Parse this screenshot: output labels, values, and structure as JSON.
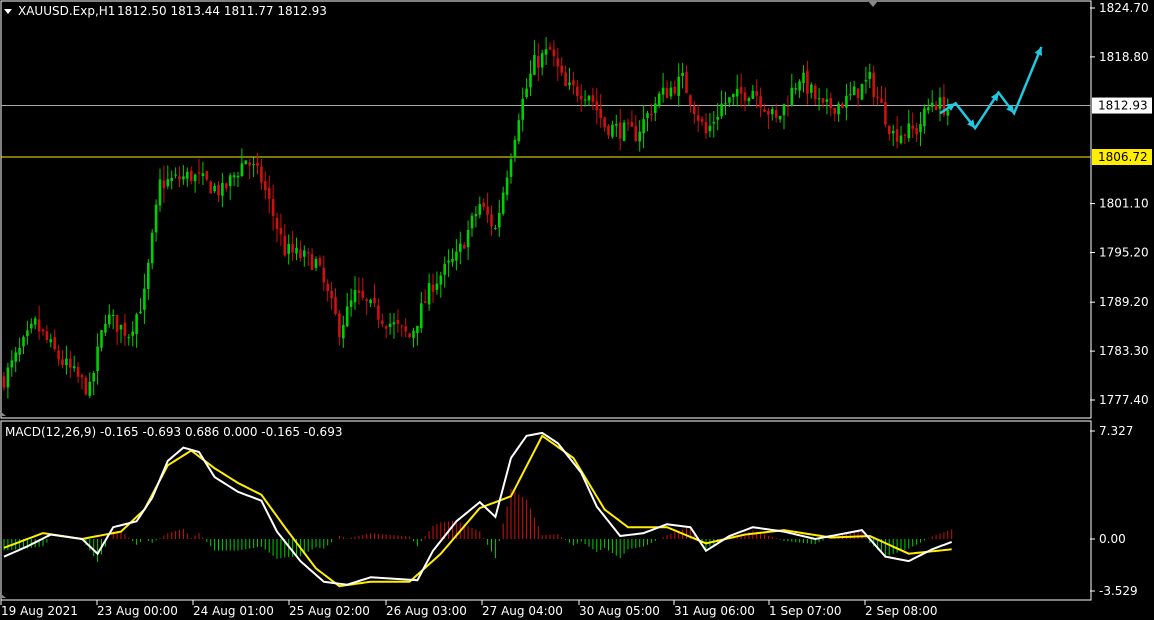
{
  "header": {
    "symbol_info": "XAUUSD.Exp,H1",
    "ohlc": "1812.50 1813.44 1811.77 1812.93"
  },
  "price_axis": {
    "labels": [
      "1824.70",
      "1818.80",
      "1801.10",
      "1795.20",
      "1789.20",
      "1783.30",
      "1777.40"
    ],
    "current_price": "1812.93",
    "level_price": "1806.72"
  },
  "macd": {
    "title": "MACD(12,26,9) -0.165 -0.693 0.686 0.000 -0.165 -0.693",
    "axis_labels": [
      "7.327",
      "0.00",
      "-3.529"
    ]
  },
  "time_axis": {
    "labels": [
      "19 Aug 2021",
      "23 Aug 00:00",
      "24 Aug 01:00",
      "25 Aug 02:00",
      "26 Aug 03:00",
      "27 Aug 04:00",
      "30 Aug 05:00",
      "31 Aug 06:00",
      "1 Sep 07:00",
      "2 Sep 08:00"
    ]
  },
  "colors": {
    "background": "#000000",
    "bull_candle": "#00d000",
    "bear_candle": "#d01010",
    "macd_line": "#ffffff",
    "signal_line": "#ffee00",
    "forecast_arrow": "#20c8e0",
    "level_line": "#ffee00",
    "current_line": "#aaaaaa"
  },
  "chart_data": [
    {
      "type": "candlestick",
      "symbol": "XAUUSD",
      "timeframe": "H1",
      "ylim": [
        1775.0,
        1827.0
      ],
      "anchors": [
        {
          "t": 0,
          "p": 1780.0
        },
        {
          "t": 8,
          "p": 1786.5
        },
        {
          "t": 14,
          "p": 1782.5
        },
        {
          "t": 22,
          "p": 1778.5
        },
        {
          "t": 26,
          "p": 1787.5
        },
        {
          "t": 32,
          "p": 1785.5
        },
        {
          "t": 36,
          "p": 1790.0
        },
        {
          "t": 40,
          "p": 1803.5
        },
        {
          "t": 48,
          "p": 1804.5
        },
        {
          "t": 56,
          "p": 1802.5
        },
        {
          "t": 62,
          "p": 1806.5
        },
        {
          "t": 66,
          "p": 1804.0
        },
        {
          "t": 72,
          "p": 1795.5
        },
        {
          "t": 80,
          "p": 1794.0
        },
        {
          "t": 86,
          "p": 1786.0
        },
        {
          "t": 90,
          "p": 1790.0
        },
        {
          "t": 98,
          "p": 1787.0
        },
        {
          "t": 104,
          "p": 1785.0
        },
        {
          "t": 110,
          "p": 1791.5
        },
        {
          "t": 116,
          "p": 1794.5
        },
        {
          "t": 122,
          "p": 1801.0
        },
        {
          "t": 126,
          "p": 1798.0
        },
        {
          "t": 132,
          "p": 1812.0
        },
        {
          "t": 136,
          "p": 1818.0
        },
        {
          "t": 140,
          "p": 1819.5
        },
        {
          "t": 144,
          "p": 1815.0
        },
        {
          "t": 150,
          "p": 1814.5
        },
        {
          "t": 154,
          "p": 1810.5
        },
        {
          "t": 162,
          "p": 1809.5
        },
        {
          "t": 168,
          "p": 1814.0
        },
        {
          "t": 174,
          "p": 1816.0
        },
        {
          "t": 180,
          "p": 1809.5
        },
        {
          "t": 184,
          "p": 1813.0
        },
        {
          "t": 192,
          "p": 1815.0
        },
        {
          "t": 198,
          "p": 1811.0
        },
        {
          "t": 204,
          "p": 1816.5
        },
        {
          "t": 210,
          "p": 1812.5
        },
        {
          "t": 216,
          "p": 1813.5
        },
        {
          "t": 222,
          "p": 1816.0
        },
        {
          "t": 228,
          "p": 1809.5
        },
        {
          "t": 234,
          "p": 1810.0
        },
        {
          "t": 238,
          "p": 1813.5
        },
        {
          "t": 242,
          "p": 1812.5
        }
      ],
      "forecast_path": [
        {
          "t": 240,
          "p": 1812.0
        },
        {
          "t": 244,
          "p": 1813.2
        },
        {
          "t": 249,
          "p": 1810.2
        },
        {
          "t": 255,
          "p": 1814.5
        },
        {
          "t": 259,
          "p": 1812.0
        },
        {
          "t": 266,
          "p": 1820.0
        }
      ]
    },
    {
      "type": "line",
      "title": "MACD(12,26,9) -0.165 -0.693 0.686 0.000 -0.165 -0.693",
      "ylim": [
        -3.529,
        7.327
      ],
      "anchors_macd": [
        {
          "t": 0,
          "v": -1.2
        },
        {
          "t": 6,
          "v": -0.5
        },
        {
          "t": 12,
          "v": 0.3
        },
        {
          "t": 20,
          "v": 0.0
        },
        {
          "t": 24,
          "v": -1.0
        },
        {
          "t": 28,
          "v": 0.8
        },
        {
          "t": 34,
          "v": 1.2
        },
        {
          "t": 38,
          "v": 2.8
        },
        {
          "t": 42,
          "v": 5.3
        },
        {
          "t": 46,
          "v": 6.2
        },
        {
          "t": 50,
          "v": 5.9
        },
        {
          "t": 54,
          "v": 4.2
        },
        {
          "t": 60,
          "v": 3.2
        },
        {
          "t": 66,
          "v": 2.6
        },
        {
          "t": 70,
          "v": 0.5
        },
        {
          "t": 76,
          "v": -1.5
        },
        {
          "t": 82,
          "v": -2.9
        },
        {
          "t": 88,
          "v": -3.1
        },
        {
          "t": 94,
          "v": -2.6
        },
        {
          "t": 100,
          "v": -2.7
        },
        {
          "t": 106,
          "v": -2.8
        },
        {
          "t": 110,
          "v": -0.8
        },
        {
          "t": 116,
          "v": 1.2
        },
        {
          "t": 122,
          "v": 2.5
        },
        {
          "t": 126,
          "v": 1.5
        },
        {
          "t": 130,
          "v": 5.5
        },
        {
          "t": 134,
          "v": 7.0
        },
        {
          "t": 138,
          "v": 7.2
        },
        {
          "t": 142,
          "v": 6.5
        },
        {
          "t": 148,
          "v": 4.5
        },
        {
          "t": 152,
          "v": 2.2
        },
        {
          "t": 158,
          "v": 0.2
        },
        {
          "t": 164,
          "v": 0.4
        },
        {
          "t": 170,
          "v": 1.0
        },
        {
          "t": 176,
          "v": 0.8
        },
        {
          "t": 180,
          "v": -0.8
        },
        {
          "t": 186,
          "v": 0.2
        },
        {
          "t": 192,
          "v": 0.8
        },
        {
          "t": 200,
          "v": 0.5
        },
        {
          "t": 208,
          "v": 0.0
        },
        {
          "t": 214,
          "v": 0.3
        },
        {
          "t": 220,
          "v": 0.6
        },
        {
          "t": 226,
          "v": -1.2
        },
        {
          "t": 232,
          "v": -1.5
        },
        {
          "t": 238,
          "v": -0.7
        },
        {
          "t": 243,
          "v": -0.2
        }
      ],
      "anchors_signal": [
        {
          "t": 0,
          "v": -0.6
        },
        {
          "t": 10,
          "v": 0.4
        },
        {
          "t": 20,
          "v": 0.0
        },
        {
          "t": 30,
          "v": 0.5
        },
        {
          "t": 36,
          "v": 2.0
        },
        {
          "t": 42,
          "v": 5.0
        },
        {
          "t": 48,
          "v": 6.0
        },
        {
          "t": 54,
          "v": 4.8
        },
        {
          "t": 60,
          "v": 3.8
        },
        {
          "t": 66,
          "v": 3.0
        },
        {
          "t": 72,
          "v": 0.8
        },
        {
          "t": 80,
          "v": -2.0
        },
        {
          "t": 86,
          "v": -3.2
        },
        {
          "t": 94,
          "v": -2.9
        },
        {
          "t": 104,
          "v": -2.9
        },
        {
          "t": 112,
          "v": -1.0
        },
        {
          "t": 122,
          "v": 2.1
        },
        {
          "t": 130,
          "v": 2.9
        },
        {
          "t": 138,
          "v": 7.0
        },
        {
          "t": 146,
          "v": 5.5
        },
        {
          "t": 154,
          "v": 2.0
        },
        {
          "t": 160,
          "v": 0.8
        },
        {
          "t": 170,
          "v": 0.8
        },
        {
          "t": 180,
          "v": -0.3
        },
        {
          "t": 190,
          "v": 0.3
        },
        {
          "t": 200,
          "v": 0.6
        },
        {
          "t": 212,
          "v": 0.1
        },
        {
          "t": 222,
          "v": 0.2
        },
        {
          "t": 232,
          "v": -1.0
        },
        {
          "t": 243,
          "v": -0.7
        }
      ]
    }
  ]
}
